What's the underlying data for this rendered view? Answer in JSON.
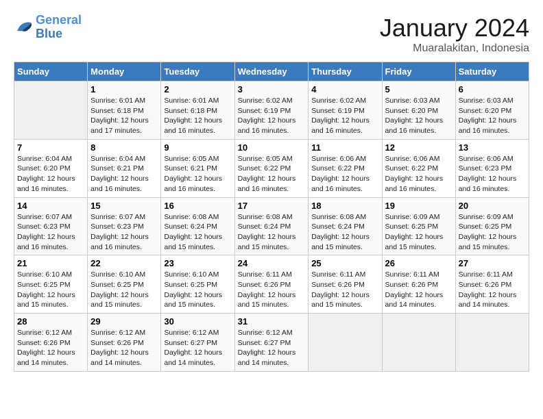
{
  "header": {
    "logo_line1": "General",
    "logo_line2": "Blue",
    "title": "January 2024",
    "subtitle": "Muaralakitan, Indonesia"
  },
  "days_of_week": [
    "Sunday",
    "Monday",
    "Tuesday",
    "Wednesday",
    "Thursday",
    "Friday",
    "Saturday"
  ],
  "weeks": [
    [
      {
        "day": "",
        "info": ""
      },
      {
        "day": "1",
        "info": "Sunrise: 6:01 AM\nSunset: 6:18 PM\nDaylight: 12 hours\nand 17 minutes."
      },
      {
        "day": "2",
        "info": "Sunrise: 6:01 AM\nSunset: 6:18 PM\nDaylight: 12 hours\nand 16 minutes."
      },
      {
        "day": "3",
        "info": "Sunrise: 6:02 AM\nSunset: 6:19 PM\nDaylight: 12 hours\nand 16 minutes."
      },
      {
        "day": "4",
        "info": "Sunrise: 6:02 AM\nSunset: 6:19 PM\nDaylight: 12 hours\nand 16 minutes."
      },
      {
        "day": "5",
        "info": "Sunrise: 6:03 AM\nSunset: 6:20 PM\nDaylight: 12 hours\nand 16 minutes."
      },
      {
        "day": "6",
        "info": "Sunrise: 6:03 AM\nSunset: 6:20 PM\nDaylight: 12 hours\nand 16 minutes."
      }
    ],
    [
      {
        "day": "7",
        "info": "Sunrise: 6:04 AM\nSunset: 6:20 PM\nDaylight: 12 hours\nand 16 minutes."
      },
      {
        "day": "8",
        "info": "Sunrise: 6:04 AM\nSunset: 6:21 PM\nDaylight: 12 hours\nand 16 minutes."
      },
      {
        "day": "9",
        "info": "Sunrise: 6:05 AM\nSunset: 6:21 PM\nDaylight: 12 hours\nand 16 minutes."
      },
      {
        "day": "10",
        "info": "Sunrise: 6:05 AM\nSunset: 6:22 PM\nDaylight: 12 hours\nand 16 minutes."
      },
      {
        "day": "11",
        "info": "Sunrise: 6:06 AM\nSunset: 6:22 PM\nDaylight: 12 hours\nand 16 minutes."
      },
      {
        "day": "12",
        "info": "Sunrise: 6:06 AM\nSunset: 6:22 PM\nDaylight: 12 hours\nand 16 minutes."
      },
      {
        "day": "13",
        "info": "Sunrise: 6:06 AM\nSunset: 6:23 PM\nDaylight: 12 hours\nand 16 minutes."
      }
    ],
    [
      {
        "day": "14",
        "info": "Sunrise: 6:07 AM\nSunset: 6:23 PM\nDaylight: 12 hours\nand 16 minutes."
      },
      {
        "day": "15",
        "info": "Sunrise: 6:07 AM\nSunset: 6:23 PM\nDaylight: 12 hours\nand 16 minutes."
      },
      {
        "day": "16",
        "info": "Sunrise: 6:08 AM\nSunset: 6:24 PM\nDaylight: 12 hours\nand 15 minutes."
      },
      {
        "day": "17",
        "info": "Sunrise: 6:08 AM\nSunset: 6:24 PM\nDaylight: 12 hours\nand 15 minutes."
      },
      {
        "day": "18",
        "info": "Sunrise: 6:08 AM\nSunset: 6:24 PM\nDaylight: 12 hours\nand 15 minutes."
      },
      {
        "day": "19",
        "info": "Sunrise: 6:09 AM\nSunset: 6:25 PM\nDaylight: 12 hours\nand 15 minutes."
      },
      {
        "day": "20",
        "info": "Sunrise: 6:09 AM\nSunset: 6:25 PM\nDaylight: 12 hours\nand 15 minutes."
      }
    ],
    [
      {
        "day": "21",
        "info": "Sunrise: 6:10 AM\nSunset: 6:25 PM\nDaylight: 12 hours\nand 15 minutes."
      },
      {
        "day": "22",
        "info": "Sunrise: 6:10 AM\nSunset: 6:25 PM\nDaylight: 12 hours\nand 15 minutes."
      },
      {
        "day": "23",
        "info": "Sunrise: 6:10 AM\nSunset: 6:25 PM\nDaylight: 12 hours\nand 15 minutes."
      },
      {
        "day": "24",
        "info": "Sunrise: 6:11 AM\nSunset: 6:26 PM\nDaylight: 12 hours\nand 15 minutes."
      },
      {
        "day": "25",
        "info": "Sunrise: 6:11 AM\nSunset: 6:26 PM\nDaylight: 12 hours\nand 15 minutes."
      },
      {
        "day": "26",
        "info": "Sunrise: 6:11 AM\nSunset: 6:26 PM\nDaylight: 12 hours\nand 14 minutes."
      },
      {
        "day": "27",
        "info": "Sunrise: 6:11 AM\nSunset: 6:26 PM\nDaylight: 12 hours\nand 14 minutes."
      }
    ],
    [
      {
        "day": "28",
        "info": "Sunrise: 6:12 AM\nSunset: 6:26 PM\nDaylight: 12 hours\nand 14 minutes."
      },
      {
        "day": "29",
        "info": "Sunrise: 6:12 AM\nSunset: 6:26 PM\nDaylight: 12 hours\nand 14 minutes."
      },
      {
        "day": "30",
        "info": "Sunrise: 6:12 AM\nSunset: 6:27 PM\nDaylight: 12 hours\nand 14 minutes."
      },
      {
        "day": "31",
        "info": "Sunrise: 6:12 AM\nSunset: 6:27 PM\nDaylight: 12 hours\nand 14 minutes."
      },
      {
        "day": "",
        "info": ""
      },
      {
        "day": "",
        "info": ""
      },
      {
        "day": "",
        "info": ""
      }
    ]
  ]
}
